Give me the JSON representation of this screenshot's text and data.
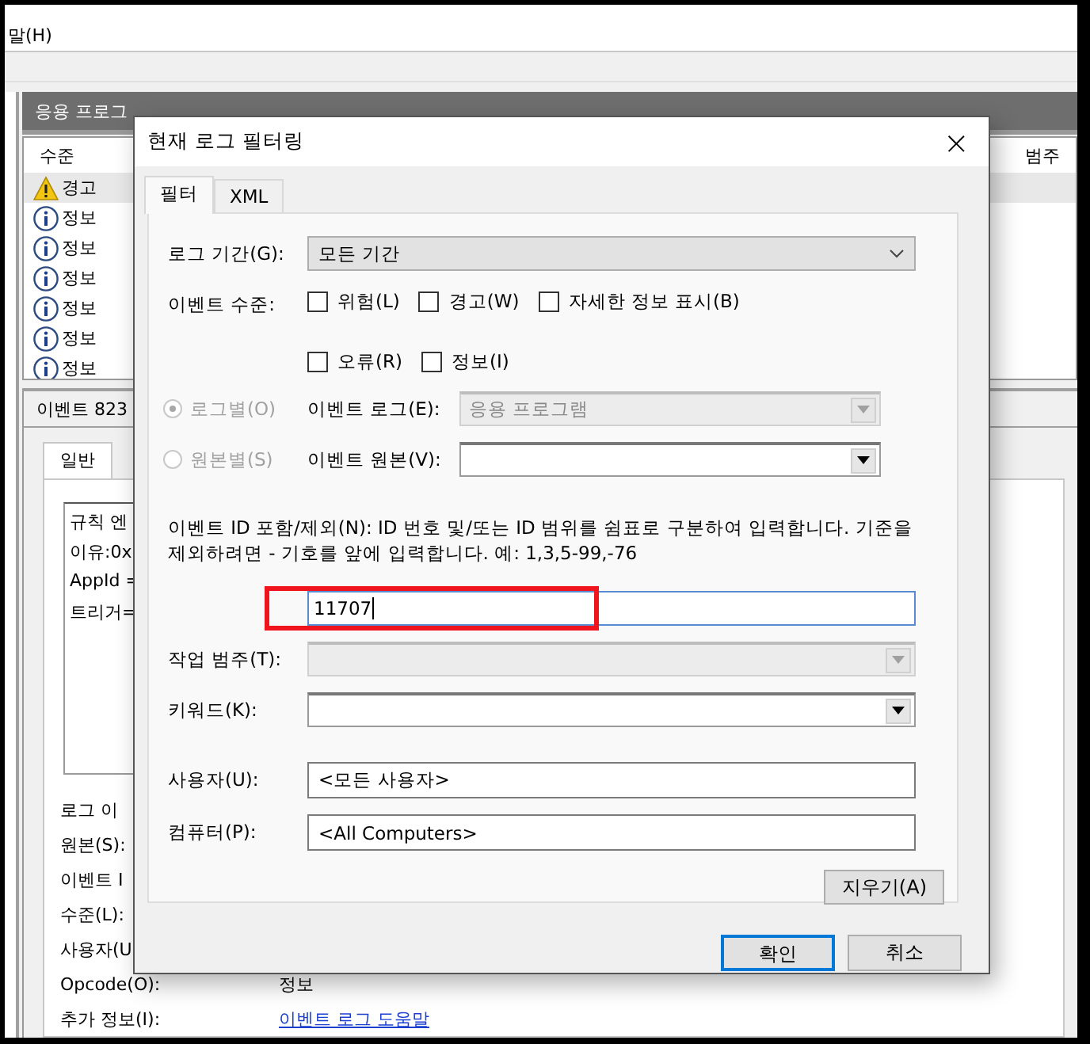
{
  "menu_bar": {
    "items": [
      "말(H)"
    ]
  },
  "log_pane": {
    "title": "응용 프로그",
    "columns": [
      "수준",
      "범주"
    ],
    "rows": [
      {
        "kind": "warning",
        "level": "경고",
        "selected": true
      },
      {
        "kind": "info",
        "level": "정보",
        "selected": false
      },
      {
        "kind": "info",
        "level": "정보",
        "selected": false
      },
      {
        "kind": "info",
        "level": "정보",
        "selected": false
      },
      {
        "kind": "info",
        "level": "정보",
        "selected": false
      },
      {
        "kind": "info",
        "level": "정보",
        "selected": false
      },
      {
        "kind": "info",
        "level": "정보",
        "selected": false
      }
    ]
  },
  "event_pane": {
    "title": "이벤트 823",
    "tabs": [
      {
        "label": "일반",
        "selected": true
      }
    ],
    "description_lines": [
      "규칙 엔",
      "이유:0x",
      "AppId =",
      "트리거="
    ],
    "properties": [
      {
        "label": "로그 이"
      },
      {
        "label": "원본(S):"
      },
      {
        "label": "이벤트 I"
      },
      {
        "label": "수준(L):"
      },
      {
        "label": "사용자(U"
      },
      {
        "label": "Opcode(O):",
        "value": "정보"
      },
      {
        "label": "추가 정보(I):",
        "link": "이벤트 로그 도움말"
      }
    ]
  },
  "dialog": {
    "title": "현재 로그 필터링",
    "close": "×",
    "tabs": [
      {
        "label": "필터",
        "selected": true
      },
      {
        "label": "XML",
        "selected": false
      }
    ],
    "logged": {
      "label": "로그 기간(G):",
      "value": "모든 기간"
    },
    "event_level": {
      "label": "이벤트 수준:",
      "options": [
        {
          "label": "위험(L)",
          "checked": false
        },
        {
          "label": "경고(W)",
          "checked": false
        },
        {
          "label": "자세한 정보 표시(B)",
          "checked": false
        },
        {
          "label": "오류(R)",
          "checked": false
        },
        {
          "label": "정보(I)",
          "checked": false
        }
      ]
    },
    "sources": [
      {
        "radio": "로그별(O)",
        "selected": true,
        "disabled": true,
        "label": "이벤트 로그(E):",
        "value": "응용 프로그램",
        "combo_disabled": true
      },
      {
        "radio": "원본별(S)",
        "selected": false,
        "disabled": true,
        "label": "이벤트 원본(V):",
        "combo_disabled": false
      }
    ],
    "id_help": "이벤트 ID 포함/제외(N): ID 번호 및/또는 ID 범위를 쉼표로 구분하여 입력합니다. 기준을 제외하려면 - 기호를 앞에 입력합니다. 예: 1,3,5-99,-76",
    "id_filter": {
      "value": "11707",
      "highlight": true
    },
    "fields": [
      {
        "kind": "combo",
        "label": "작업 범주(T):",
        "disabled": true
      },
      {
        "kind": "combo",
        "label": "키워드(K):",
        "disabled": false
      },
      {
        "kind": "text",
        "label": "사용자(U):",
        "value": "<모든 사용자>"
      },
      {
        "kind": "text",
        "label": "컴퓨터(P):",
        "value": "<All Computers>"
      }
    ],
    "clear_button": "지우기(A)",
    "buttons": [
      {
        "label": "확인",
        "default": true
      },
      {
        "label": "취소",
        "default": false
      }
    ]
  }
}
